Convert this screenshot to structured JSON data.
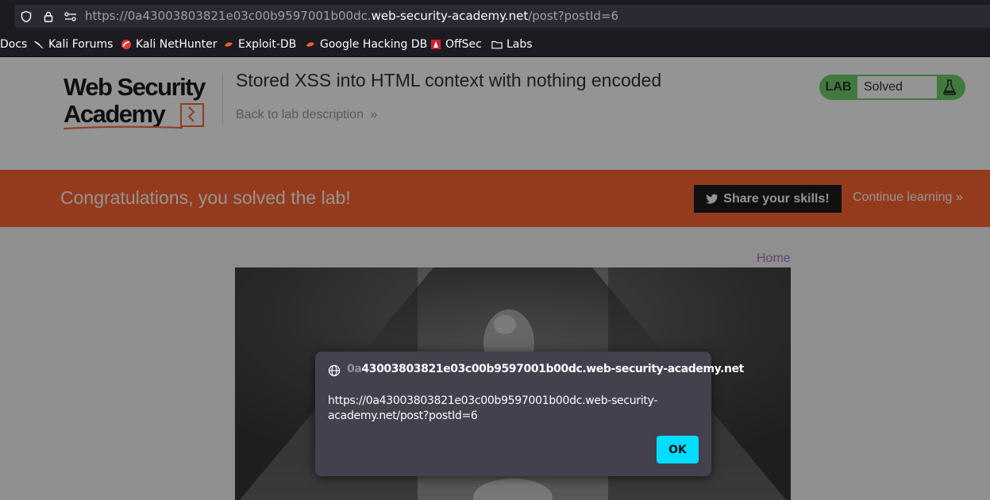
{
  "browser": {
    "url_prefix": "https://0a43003803821e03c00b9597001b00dc.",
    "url_domain": "web-security-academy.net",
    "url_path": "/post?postId=6",
    "bookmarks": [
      {
        "label": "Docs",
        "icon": "none"
      },
      {
        "label": "Kali Forums",
        "icon": "kali-dragon-icon"
      },
      {
        "label": "Kali NetHunter",
        "icon": "nethunter-icon"
      },
      {
        "label": "Exploit-DB",
        "icon": "exploitdb-icon"
      },
      {
        "label": "Google Hacking DB",
        "icon": "ghdb-icon"
      },
      {
        "label": "OffSec",
        "icon": "offsec-icon"
      },
      {
        "label": "Labs",
        "icon": "folder-icon"
      }
    ]
  },
  "header": {
    "logo_line1": "Web Security",
    "logo_line2": "Academy",
    "lab_title": "Stored XSS into HTML context with nothing encoded",
    "back_link": "Back to lab description",
    "lab_tag": "LAB",
    "lab_status": "Solved"
  },
  "banner": {
    "message": "Congratulations, you solved the lab!",
    "share_label": "Share your skills!",
    "continue_label": "Continue learning"
  },
  "page": {
    "home_link": "Home"
  },
  "dialog": {
    "origin_faded": "0a",
    "origin_clear": "43003803821e03c00b9597001b00dc.web-security-academy.net",
    "message": "https://0a43003803821e03c00b9597001b00dc.web-security-academy.net/post?postId=6",
    "ok_label": "OK"
  },
  "colors": {
    "banner": "#ff6633",
    "lab_solved": "#70d16d",
    "ok_button": "#00ddff",
    "dialog_bg": "#42414d"
  }
}
